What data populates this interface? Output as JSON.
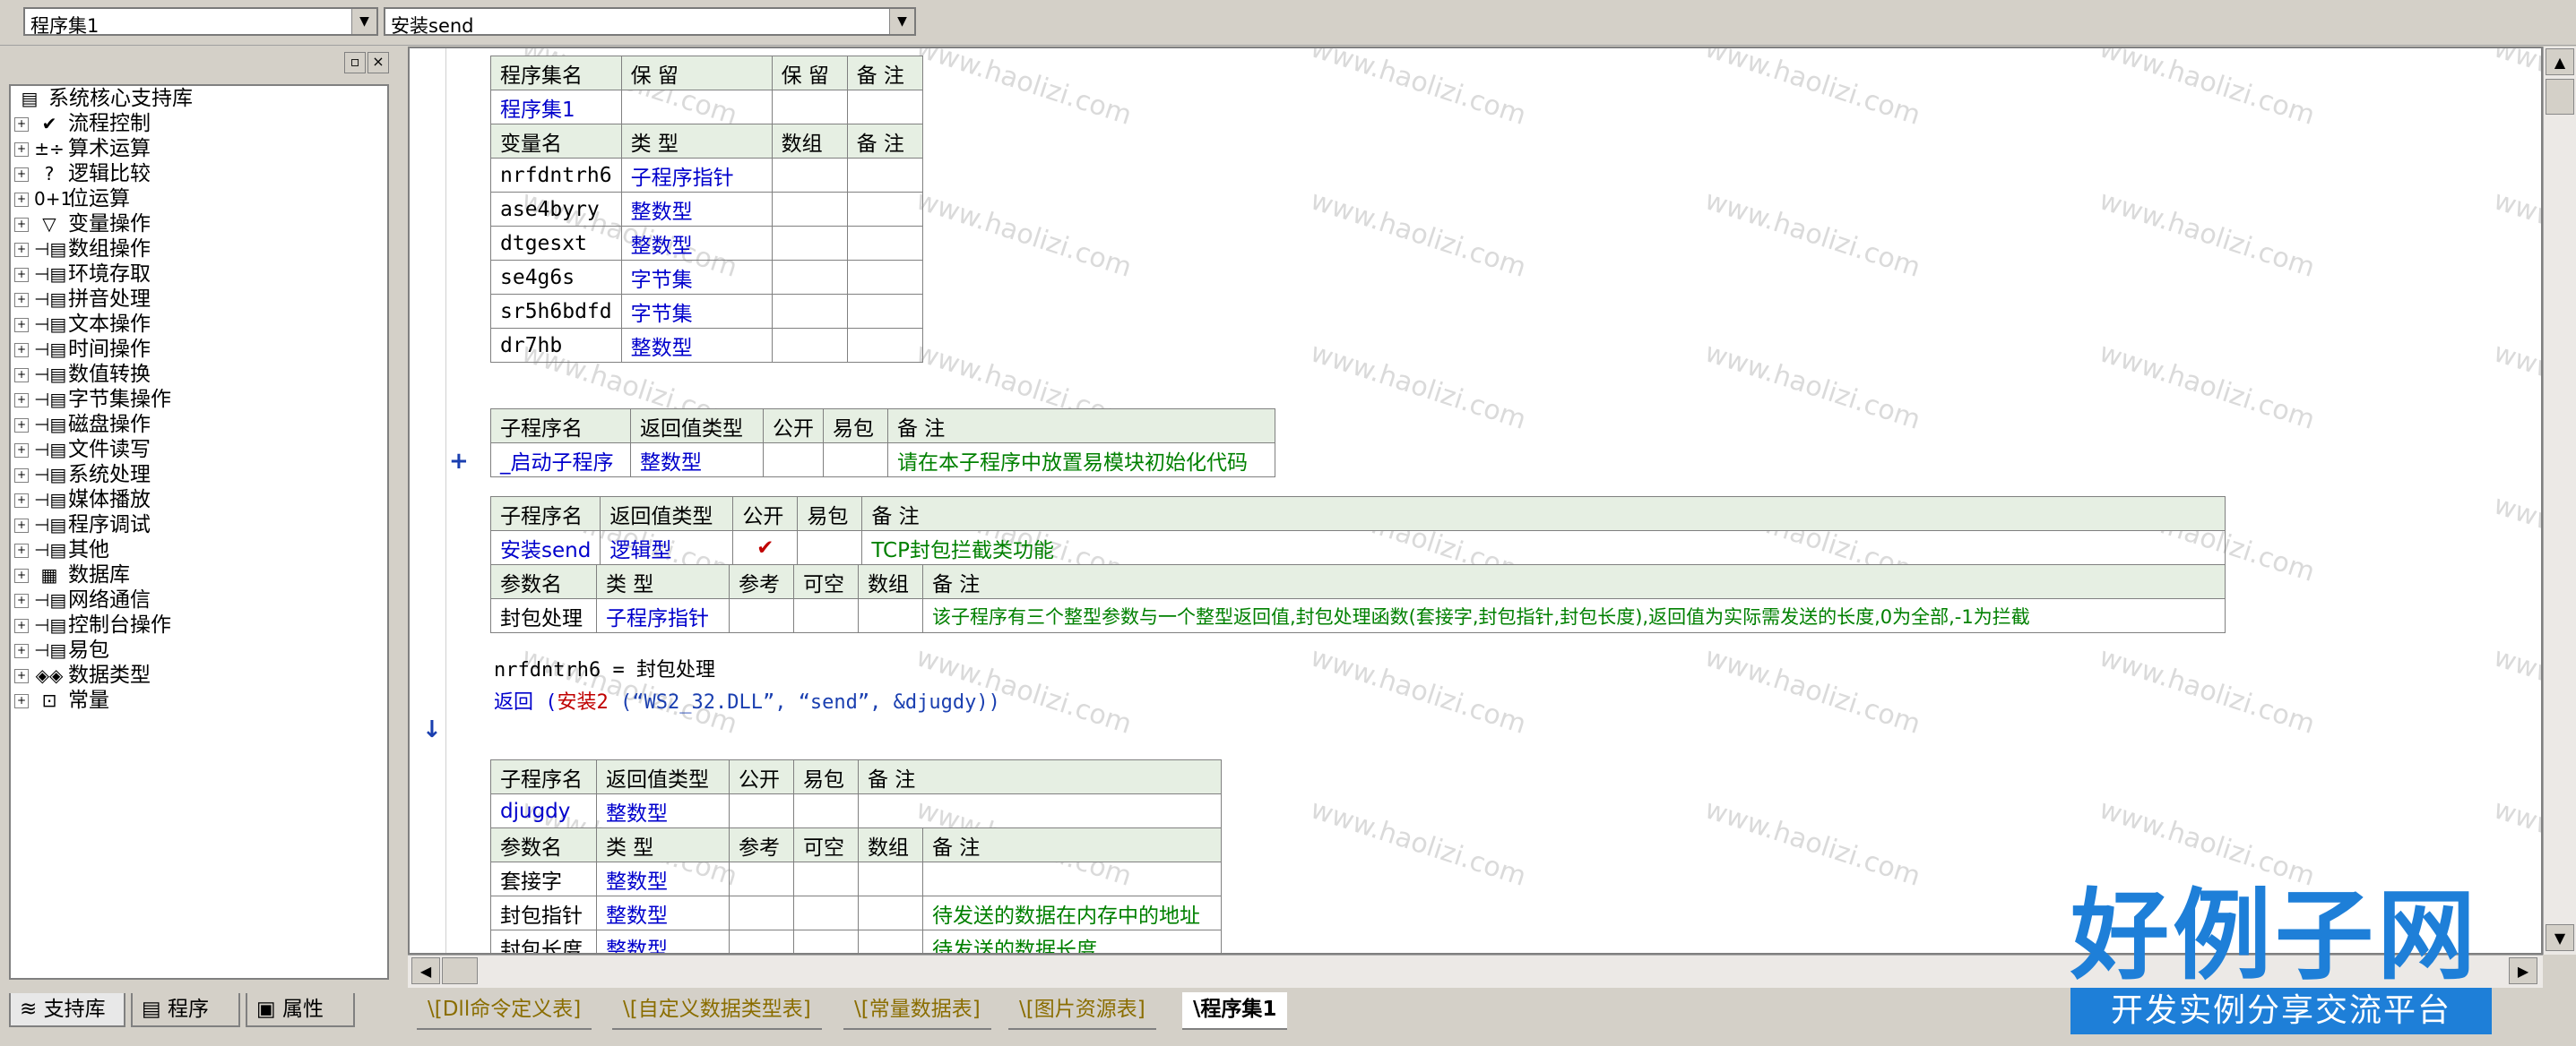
{
  "topbar": {
    "program_set_value": "程序集1",
    "subroutine_value": "安装send"
  },
  "left_panel": {
    "tree_root": "系统核心支持库",
    "tree_items": [
      {
        "label": "流程控制",
        "icon": "flow-control-icon",
        "glyph": "✔"
      },
      {
        "label": "算术运算",
        "icon": "arithmetic-icon",
        "glyph": "±÷"
      },
      {
        "label": "逻辑比较",
        "icon": "logic-compare-icon",
        "glyph": "?"
      },
      {
        "label": "位运算",
        "icon": "bit-operation-icon",
        "glyph": "0+1"
      },
      {
        "label": "变量操作",
        "icon": "variable-icon",
        "glyph": "▽"
      },
      {
        "label": "数组操作",
        "icon": "module-icon",
        "glyph": "⊣▤"
      },
      {
        "label": "环境存取",
        "icon": "module-icon",
        "glyph": "⊣▤"
      },
      {
        "label": "拼音处理",
        "icon": "module-icon",
        "glyph": "⊣▤"
      },
      {
        "label": "文本操作",
        "icon": "module-icon",
        "glyph": "⊣▤"
      },
      {
        "label": "时间操作",
        "icon": "module-icon",
        "glyph": "⊣▤"
      },
      {
        "label": "数值转换",
        "icon": "module-icon",
        "glyph": "⊣▤"
      },
      {
        "label": "字节集操作",
        "icon": "module-icon",
        "glyph": "⊣▤"
      },
      {
        "label": "磁盘操作",
        "icon": "module-icon",
        "glyph": "⊣▤"
      },
      {
        "label": "文件读写",
        "icon": "module-icon",
        "glyph": "⊣▤"
      },
      {
        "label": "系统处理",
        "icon": "module-icon",
        "glyph": "⊣▤"
      },
      {
        "label": "媒体播放",
        "icon": "module-icon",
        "glyph": "⊣▤"
      },
      {
        "label": "程序调试",
        "icon": "module-icon",
        "glyph": "⊣▤"
      },
      {
        "label": "其他",
        "icon": "module-icon",
        "glyph": "⊣▤"
      },
      {
        "label": "数据库",
        "icon": "database-icon",
        "glyph": "▦"
      },
      {
        "label": "网络通信",
        "icon": "module-icon",
        "glyph": "⊣▤"
      },
      {
        "label": "控制台操作",
        "icon": "module-icon",
        "glyph": "⊣▤"
      },
      {
        "label": "易包",
        "icon": "module-icon",
        "glyph": "⊣▤"
      },
      {
        "label": "数据类型",
        "icon": "datatype-icon",
        "glyph": "◈◈"
      },
      {
        "label": "常量",
        "icon": "constant-icon",
        "glyph": "⊡"
      }
    ],
    "tabs": [
      "支持库",
      "程序",
      "属性"
    ]
  },
  "editor": {
    "assembly_table": {
      "headers": [
        "程序集名",
        "保 留",
        "保 留",
        "备 注"
      ],
      "row": [
        "程序集1",
        "",
        "",
        ""
      ],
      "var_headers": [
        "变量名",
        "类 型",
        "数组",
        "备 注"
      ],
      "vars": [
        [
          "nrfdntrh6",
          "子程序指针",
          "",
          ""
        ],
        [
          "ase4byry",
          "整数型",
          "",
          ""
        ],
        [
          "dtgesxt",
          "整数型",
          "",
          ""
        ],
        [
          "se4g6s",
          "字节集",
          "",
          ""
        ],
        [
          "sr5h6bdfd",
          "字节集",
          "",
          ""
        ],
        [
          "dr7hb",
          "整数型",
          "",
          ""
        ]
      ]
    },
    "startup_table": {
      "headers": [
        "子程序名",
        "返回值类型",
        "公开",
        "易包",
        "备 注"
      ],
      "row": [
        "_启动子程序",
        "整数型",
        "",
        "",
        "请在本子程序中放置易模块初始化代码"
      ],
      "gutter": "+"
    },
    "install_table": {
      "headers": [
        "子程序名",
        "返回值类型",
        "公开",
        "易包",
        "备 注"
      ],
      "row": [
        "安装send",
        "逻辑型",
        "✔",
        "",
        "TCP封包拦截类功能"
      ],
      "param_headers": [
        "参数名",
        "类 型",
        "参考",
        "可空",
        "数组",
        "备 注"
      ],
      "params": [
        [
          "封包处理",
          "子程序指针",
          "",
          "",
          "",
          "该子程序有三个整型参数与一个整型返回值,封包处理函数(套接字,封包指针,封包长度),返回值为实际需发送的长度,0为全部,-1为拦截"
        ]
      ]
    },
    "code": {
      "line1_var": "nrfdntrh6",
      "line1_op": " = ",
      "line1_val": "封包处理",
      "line2_kw": "返回",
      "line2_open": " (",
      "line2_func": "安装2",
      "line2_args": " (“WS2_32.DLL”, “send”, &djugdy))",
      "gutter_arrow": "↓"
    },
    "djugdy_table": {
      "headers": [
        "子程序名",
        "返回值类型",
        "公开",
        "易包",
        "备 注"
      ],
      "row": [
        "djugdy",
        "整数型",
        "",
        "",
        ""
      ],
      "param_headers": [
        "参数名",
        "类 型",
        "参考",
        "可空",
        "数组",
        "备 注"
      ],
      "params": [
        [
          "套接字",
          "整数型",
          "",
          "",
          "",
          ""
        ],
        [
          "封包指针",
          "整数型",
          "",
          "",
          "",
          "待发送的数据在内存中的地址"
        ],
        [
          "封包长度",
          "整数型",
          "",
          "",
          "",
          "待发送的数据长度"
        ]
      ]
    }
  },
  "bottom_tabs": [
    "\\[Dll命令定义表]",
    "\\[自定义数据类型表]",
    "\\[常量数据表]",
    "\\[图片资源表]",
    "\\程序集1"
  ],
  "watermark": "www.haolizi.com",
  "logo": {
    "main": "好例子网",
    "sub": "开发实例分享交流平台"
  }
}
